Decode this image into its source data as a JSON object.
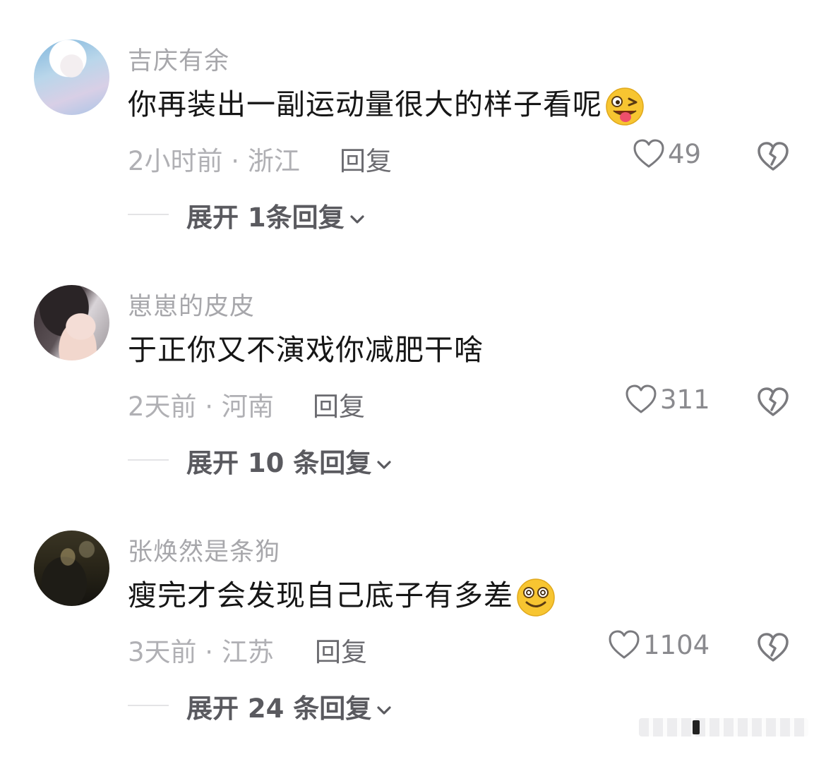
{
  "comments": [
    {
      "username": "吉庆有余",
      "text": "你再装出一副运动量很大的样子看呢",
      "emoji": "tongue-wink-emoji",
      "time_location": "2小时前 · 浙江",
      "reply_label": "回复",
      "likes": "49",
      "expand_label": "展开 1条回复"
    },
    {
      "username": "崽崽的皮皮",
      "text": "于正你又不演戏你减肥干啥",
      "emoji": "",
      "time_location": "2天前 · 河南",
      "reply_label": "回复",
      "likes": "311",
      "expand_label": "展开 10 条回复"
    },
    {
      "username": "张焕然是条狗",
      "text": "瘦完才会发现自己底子有多差",
      "emoji": "dizzy-smile-emoji",
      "time_location": "3天前 · 江苏",
      "reply_label": "回复",
      "likes": "1104",
      "expand_label": "展开 24 条回复"
    }
  ],
  "colors": {
    "username": "#a7a7ab",
    "text": "#161616",
    "meta": "#b0b0b4",
    "action": "#6b6b70",
    "icon": "#7a7a7e",
    "emoji_yellow": "#f7c531"
  }
}
